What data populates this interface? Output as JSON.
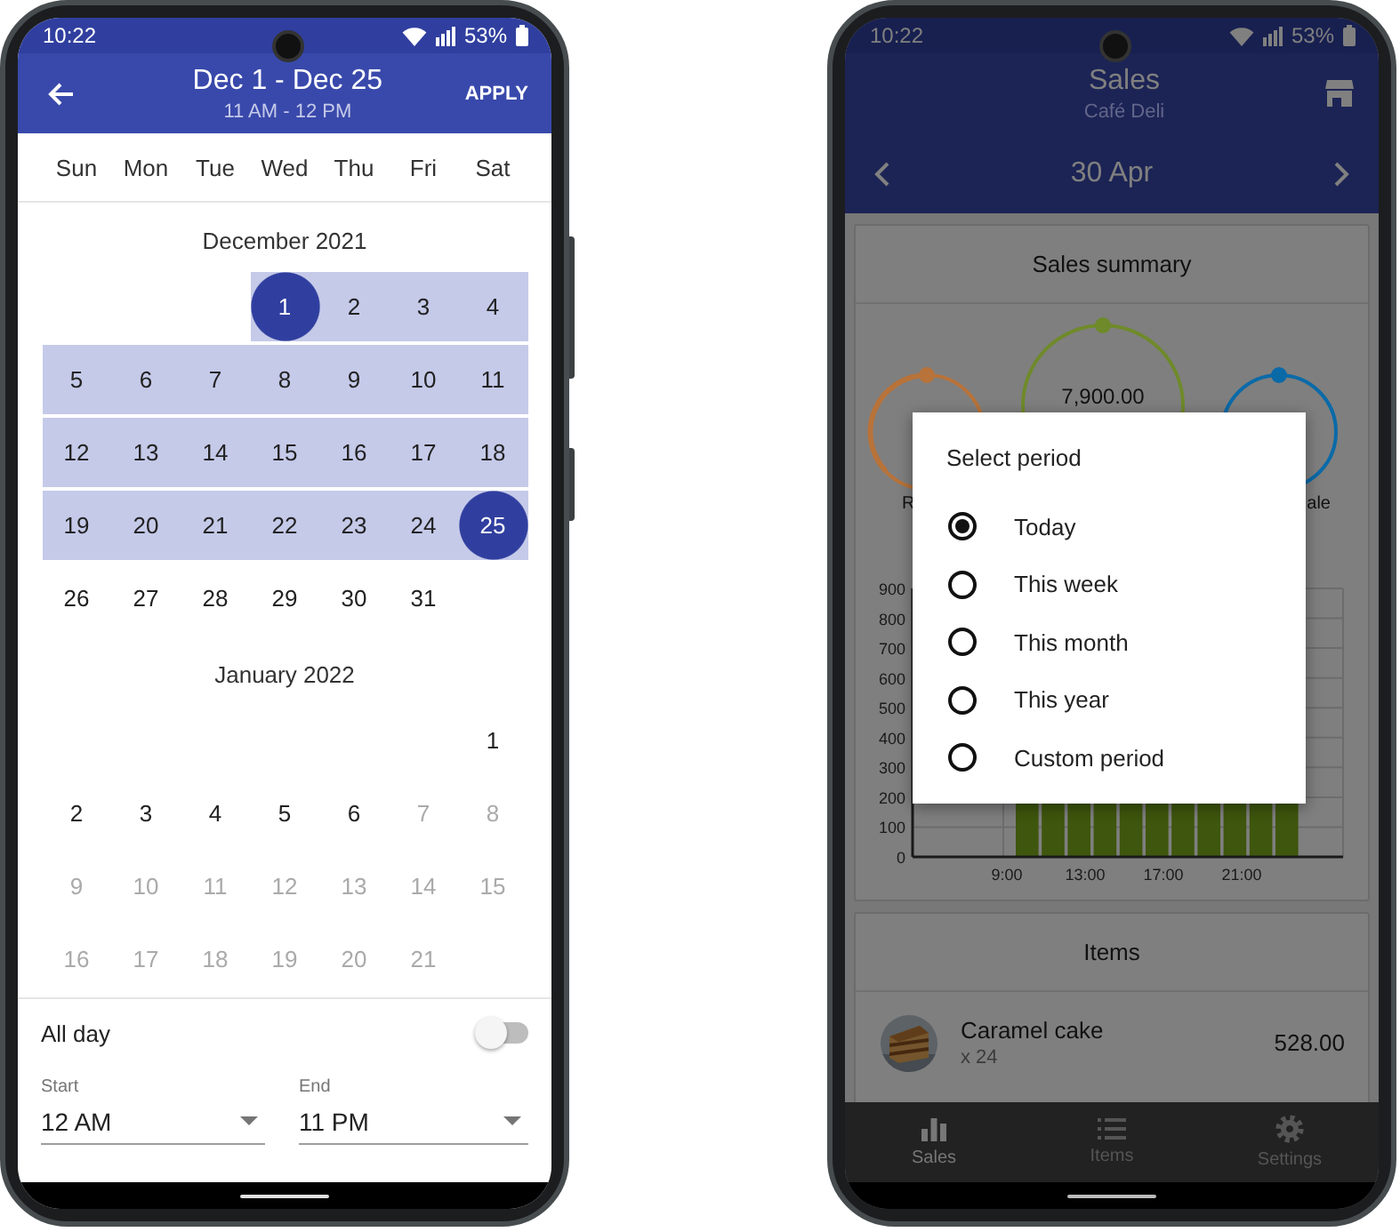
{
  "date_range_screen": {
    "status_bar": {
      "time": "10:22",
      "battery": "53%"
    },
    "header": {
      "title": "Dec 1 - Dec 25",
      "subtitle": "11 AM - 12 PM",
      "action": "APPLY"
    },
    "weekdays": [
      "Sun",
      "Mon",
      "Tue",
      "Wed",
      "Thu",
      "Fri",
      "Sat"
    ],
    "months": [
      {
        "title": "December 2021",
        "weeks": [
          [
            {
              "kind": "blank"
            },
            {
              "kind": "blank"
            },
            {
              "kind": "blank"
            },
            {
              "kind": "day",
              "day": "1",
              "selected": true,
              "in_range": true,
              "disabled": false
            },
            {
              "kind": "day",
              "day": "2",
              "selected": false,
              "in_range": true,
              "disabled": false
            },
            {
              "kind": "day",
              "day": "3",
              "selected": false,
              "in_range": true,
              "disabled": false
            },
            {
              "kind": "day",
              "day": "4",
              "selected": false,
              "in_range": true,
              "disabled": false
            }
          ],
          [
            {
              "kind": "day",
              "day": "5",
              "selected": false,
              "in_range": true,
              "disabled": false
            },
            {
              "kind": "day",
              "day": "6",
              "selected": false,
              "in_range": true,
              "disabled": false
            },
            {
              "kind": "day",
              "day": "7",
              "selected": false,
              "in_range": true,
              "disabled": false
            },
            {
              "kind": "day",
              "day": "8",
              "selected": false,
              "in_range": true,
              "disabled": false
            },
            {
              "kind": "day",
              "day": "9",
              "selected": false,
              "in_range": true,
              "disabled": false
            },
            {
              "kind": "day",
              "day": "10",
              "selected": false,
              "in_range": true,
              "disabled": false
            },
            {
              "kind": "day",
              "day": "11",
              "selected": false,
              "in_range": true,
              "disabled": false
            }
          ],
          [
            {
              "kind": "day",
              "day": "12",
              "selected": false,
              "in_range": true,
              "disabled": false
            },
            {
              "kind": "day",
              "day": "13",
              "selected": false,
              "in_range": true,
              "disabled": false
            },
            {
              "kind": "day",
              "day": "14",
              "selected": false,
              "in_range": true,
              "disabled": false
            },
            {
              "kind": "day",
              "day": "15",
              "selected": false,
              "in_range": true,
              "disabled": false
            },
            {
              "kind": "day",
              "day": "16",
              "selected": false,
              "in_range": true,
              "disabled": false
            },
            {
              "kind": "day",
              "day": "17",
              "selected": false,
              "in_range": true,
              "disabled": false
            },
            {
              "kind": "day",
              "day": "18",
              "selected": false,
              "in_range": true,
              "disabled": false
            }
          ],
          [
            {
              "kind": "day",
              "day": "19",
              "selected": false,
              "in_range": true,
              "disabled": false
            },
            {
              "kind": "day",
              "day": "20",
              "selected": false,
              "in_range": true,
              "disabled": false
            },
            {
              "kind": "day",
              "day": "21",
              "selected": false,
              "in_range": true,
              "disabled": false
            },
            {
              "kind": "day",
              "day": "22",
              "selected": false,
              "in_range": true,
              "disabled": false
            },
            {
              "kind": "day",
              "day": "23",
              "selected": false,
              "in_range": true,
              "disabled": false
            },
            {
              "kind": "day",
              "day": "24",
              "selected": false,
              "in_range": true,
              "disabled": false
            },
            {
              "kind": "day",
              "day": "25",
              "selected": true,
              "in_range": true,
              "disabled": false
            }
          ],
          [
            {
              "kind": "day",
              "day": "26",
              "selected": false,
              "in_range": false,
              "disabled": false
            },
            {
              "kind": "day",
              "day": "27",
              "selected": false,
              "in_range": false,
              "disabled": false
            },
            {
              "kind": "day",
              "day": "28",
              "selected": false,
              "in_range": false,
              "disabled": false
            },
            {
              "kind": "day",
              "day": "29",
              "selected": false,
              "in_range": false,
              "disabled": false
            },
            {
              "kind": "day",
              "day": "30",
              "selected": false,
              "in_range": false,
              "disabled": false
            },
            {
              "kind": "day",
              "day": "31",
              "selected": false,
              "in_range": false,
              "disabled": false
            },
            {
              "kind": "blank"
            }
          ]
        ]
      },
      {
        "title": "January 2022",
        "weeks": [
          [
            {
              "kind": "blank"
            },
            {
              "kind": "blank"
            },
            {
              "kind": "blank"
            },
            {
              "kind": "blank"
            },
            {
              "kind": "blank"
            },
            {
              "kind": "blank"
            },
            {
              "kind": "day",
              "day": "1",
              "selected": false,
              "in_range": false,
              "disabled": false
            }
          ],
          [
            {
              "kind": "day",
              "day": "2",
              "selected": false,
              "in_range": false,
              "disabled": false
            },
            {
              "kind": "day",
              "day": "3",
              "selected": false,
              "in_range": false,
              "disabled": false
            },
            {
              "kind": "day",
              "day": "4",
              "selected": false,
              "in_range": false,
              "disabled": false
            },
            {
              "kind": "day",
              "day": "5",
              "selected": false,
              "in_range": false,
              "disabled": false
            },
            {
              "kind": "day",
              "day": "6",
              "selected": false,
              "in_range": false,
              "disabled": false
            },
            {
              "kind": "day",
              "day": "7",
              "selected": false,
              "in_range": false,
              "disabled": true
            },
            {
              "kind": "day",
              "day": "8",
              "selected": false,
              "in_range": false,
              "disabled": true
            }
          ],
          [
            {
              "kind": "day",
              "day": "9",
              "selected": false,
              "in_range": false,
              "disabled": true
            },
            {
              "kind": "day",
              "day": "10",
              "selected": false,
              "in_range": false,
              "disabled": true
            },
            {
              "kind": "day",
              "day": "11",
              "selected": false,
              "in_range": false,
              "disabled": true
            },
            {
              "kind": "day",
              "day": "12",
              "selected": false,
              "in_range": false,
              "disabled": true
            },
            {
              "kind": "day",
              "day": "13",
              "selected": false,
              "in_range": false,
              "disabled": true
            },
            {
              "kind": "day",
              "day": "14",
              "selected": false,
              "in_range": false,
              "disabled": true
            },
            {
              "kind": "day",
              "day": "15",
              "selected": false,
              "in_range": false,
              "disabled": true
            }
          ],
          [
            {
              "kind": "day",
              "day": "16",
              "selected": false,
              "in_range": false,
              "disabled": true
            },
            {
              "kind": "day",
              "day": "17",
              "selected": false,
              "in_range": false,
              "disabled": true
            },
            {
              "kind": "day",
              "day": "18",
              "selected": false,
              "in_range": false,
              "disabled": true
            },
            {
              "kind": "day",
              "day": "19",
              "selected": false,
              "in_range": false,
              "disabled": true
            },
            {
              "kind": "day",
              "day": "20",
              "selected": false,
              "in_range": false,
              "disabled": true
            },
            {
              "kind": "day",
              "day": "21",
              "selected": false,
              "in_range": false,
              "disabled": true
            },
            {
              "kind": "blank"
            }
          ]
        ]
      }
    ],
    "all_day": {
      "label": "All day",
      "on": false
    },
    "start": {
      "label": "Start",
      "value": "12 AM"
    },
    "end": {
      "label": "End",
      "value": "11 PM"
    }
  },
  "sales_screen": {
    "status_bar": {
      "time": "10:22",
      "battery": "53%"
    },
    "header": {
      "title": "Sales",
      "subtitle": "Café Deli"
    },
    "date": "30 Apr",
    "summary": {
      "title": "Sales summary",
      "gauges": [
        {
          "label": "R",
          "color": "#b8733a"
        },
        {
          "value": "7,900.00",
          "color": "#6f8a2a"
        },
        {
          "label": "ale",
          "color": "#0a6aa8"
        }
      ],
      "y_labels": [
        "900",
        "800",
        "700",
        "600",
        "500",
        "400",
        "300",
        "200",
        "100",
        "0"
      ],
      "x_labels": [
        "9:00",
        "13:00",
        "17:00",
        "21:00"
      ]
    },
    "items": {
      "title": "Items",
      "rows": [
        {
          "name": "Caramel cake",
          "quantity": "x 24",
          "amount": "528.00"
        }
      ]
    },
    "bottom_nav": [
      {
        "label": "Sales",
        "selected": true
      },
      {
        "label": "Items",
        "selected": false
      },
      {
        "label": "Settings",
        "selected": false
      }
    ],
    "dialog": {
      "title": "Select period",
      "options": [
        {
          "label": "Today",
          "selected": true
        },
        {
          "label": "This week",
          "selected": false
        },
        {
          "label": "This month",
          "selected": false
        },
        {
          "label": "This year",
          "selected": false
        },
        {
          "label": "Custom period",
          "selected": false
        }
      ]
    }
  }
}
